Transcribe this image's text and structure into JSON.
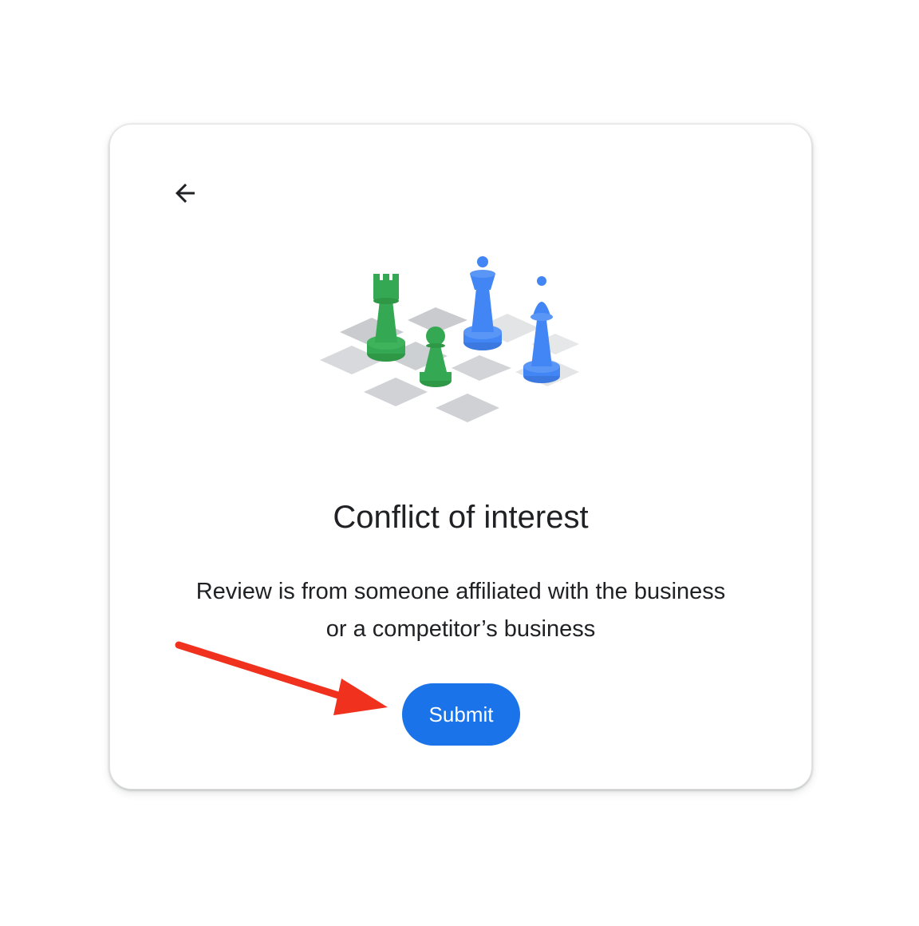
{
  "dialog": {
    "back_icon": "arrow-left-icon",
    "illustration": "chess-pieces-illustration",
    "title": "Conflict of interest",
    "description_line1": "Review is from someone affiliated with the business",
    "description_line2": "or a competitor’s business",
    "submit_label": "Submit"
  },
  "annotation": {
    "icon": "red-arrow-pointer",
    "color": "#f0311e"
  },
  "colors": {
    "accent": "#1a73e8",
    "text": "#202124",
    "green_piece": "#34a853",
    "blue_piece": "#4285f4"
  }
}
